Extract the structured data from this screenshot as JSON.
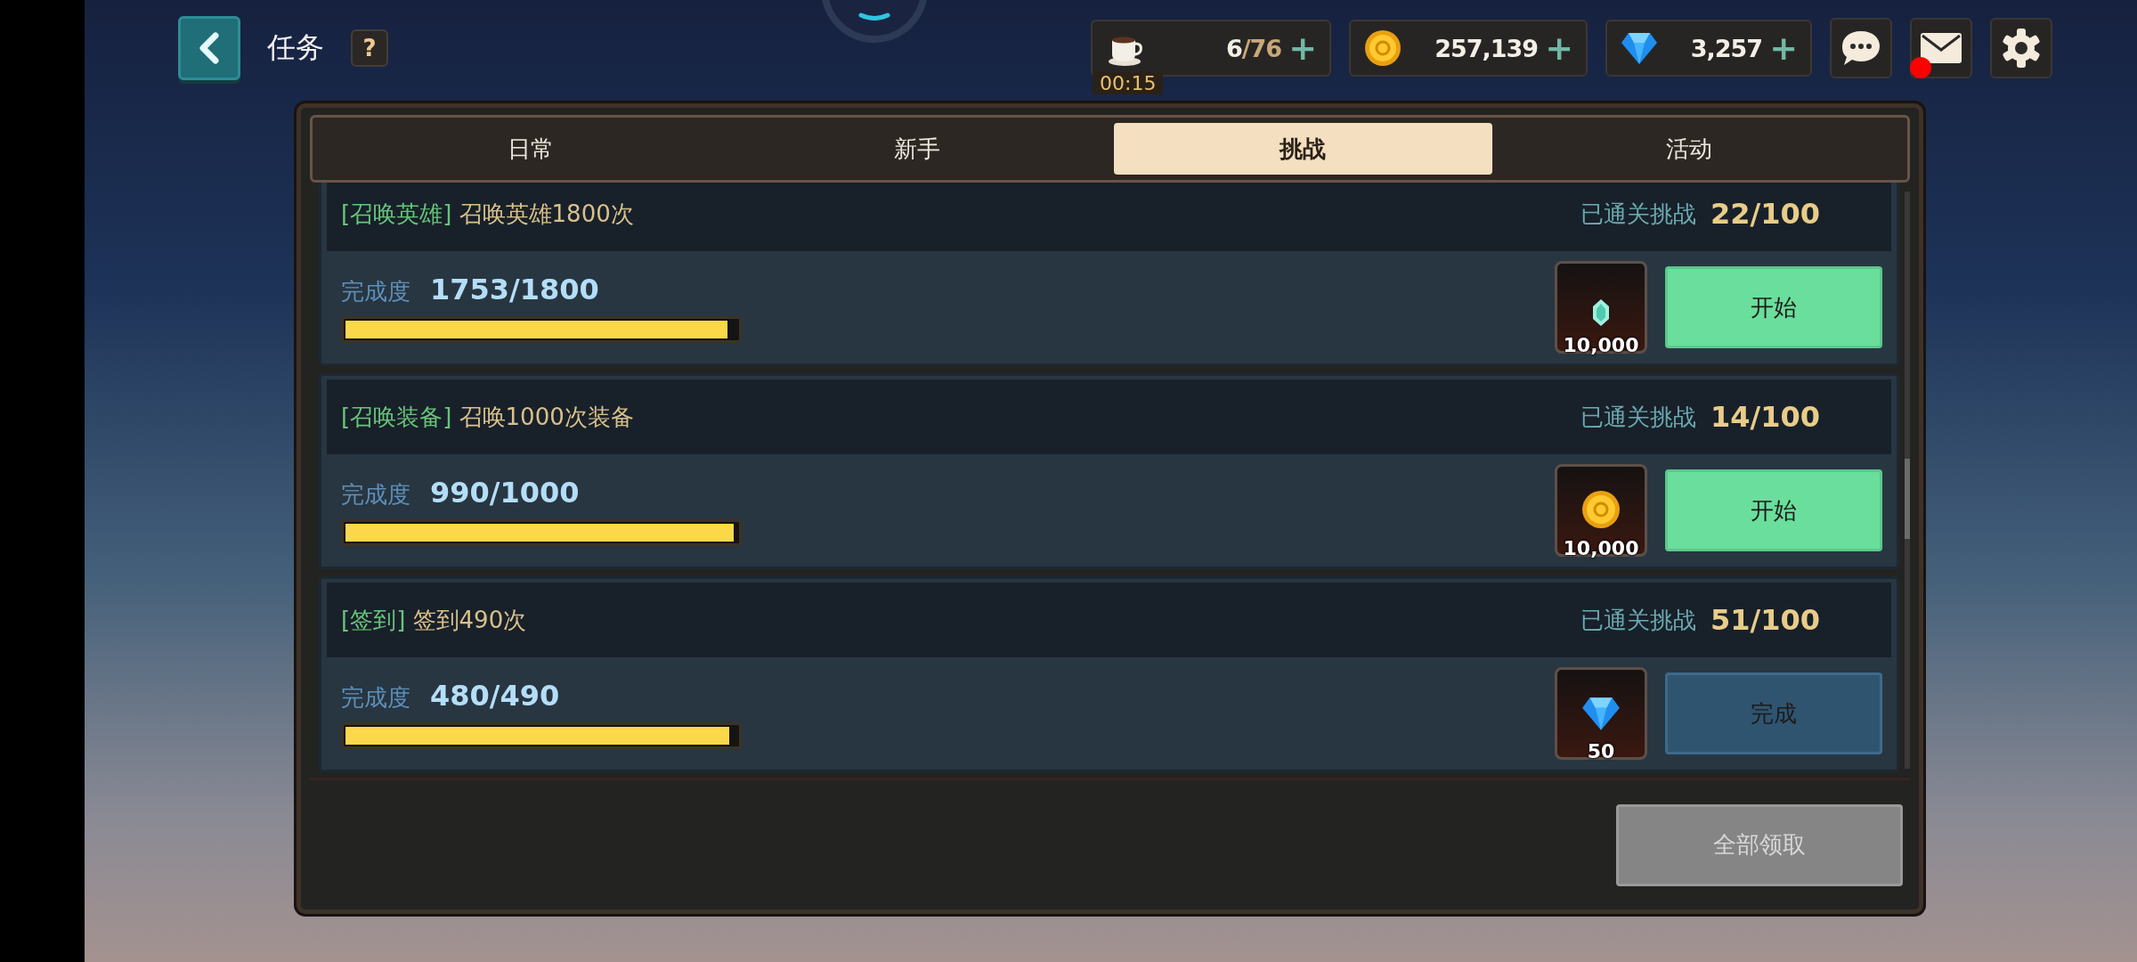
{
  "header": {
    "title": "任务",
    "help": "?"
  },
  "resources": [
    {
      "kind": "stamina",
      "value": "6",
      "max": "/76",
      "timer": "00:15",
      "plus": "+"
    },
    {
      "kind": "coin",
      "value": "257,139",
      "plus": "+"
    },
    {
      "kind": "gem",
      "value": "3,257",
      "plus": "+"
    }
  ],
  "top_buttons": [
    {
      "kind": "chat",
      "unread": false
    },
    {
      "kind": "mail",
      "unread": true
    },
    {
      "kind": "settings",
      "unread": false
    }
  ],
  "tabs": [
    {
      "label": "日常",
      "selected": false
    },
    {
      "label": "新手",
      "selected": false
    },
    {
      "label": "挑战",
      "selected": true
    },
    {
      "label": "活动",
      "selected": false
    }
  ],
  "quests": [
    {
      "category": "[召唤英雄]",
      "title": "召唤英雄1800次",
      "cleared_label": "已通关挑战",
      "cleared": "22/100",
      "progress_label": "完成度",
      "progress": "1753/1800",
      "level": 0.974,
      "reward": {
        "kind": "crystal",
        "amount": "10,000"
      },
      "action": {
        "label": "开始",
        "kind": "start"
      }
    },
    {
      "category": "[召唤装备]",
      "title": "召唤1000次装备",
      "cleared_label": "已通关挑战",
      "cleared": "14/100",
      "progress_label": "完成度",
      "progress": "990/1000",
      "level": 0.99,
      "reward": {
        "kind": "coin",
        "amount": "10,000"
      },
      "action": {
        "label": "开始",
        "kind": "start"
      }
    },
    {
      "category": "[签到]",
      "title": "签到490次",
      "cleared_label": "已通关挑战",
      "cleared": "51/100",
      "progress_label": "完成度",
      "progress": "480/490",
      "level": 0.98,
      "reward": {
        "kind": "gem",
        "amount": "50"
      },
      "action": {
        "label": "完成",
        "kind": "done"
      }
    }
  ],
  "claim_all": {
    "label": "全部领取",
    "disabled": true
  }
}
